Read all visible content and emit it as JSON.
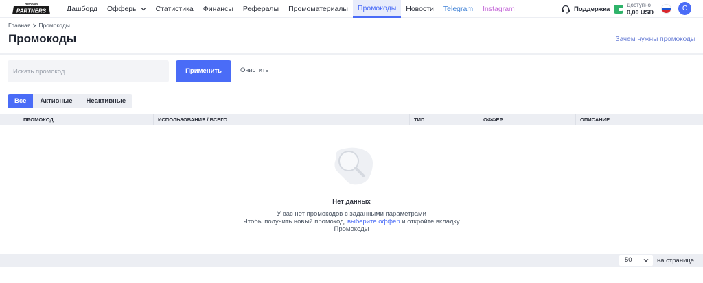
{
  "brand": {
    "logo_top": "BetBoom",
    "logo_main": "PARTNERS"
  },
  "nav": {
    "items": [
      {
        "label": "Дашборд"
      },
      {
        "label": "Офферы"
      },
      {
        "label": "Статистика"
      },
      {
        "label": "Финансы"
      },
      {
        "label": "Рефералы"
      },
      {
        "label": "Промоматериалы"
      },
      {
        "label": "Промокоды"
      },
      {
        "label": "Новости"
      },
      {
        "label": "Telegram"
      },
      {
        "label": "Instagram"
      }
    ],
    "active": "Промокоды"
  },
  "header": {
    "support": "Поддержка",
    "balance_label": "Доступно",
    "balance_value": "0,00 USD",
    "avatar_letter": "C"
  },
  "breadcrumb": {
    "home": "Главная",
    "current": "Промокоды"
  },
  "page": {
    "title": "Промокоды",
    "help_link": "Зачем нужны промокоды"
  },
  "search": {
    "placeholder": "Искать промокод",
    "value": "",
    "apply": "Применить",
    "clear": "Очистить"
  },
  "filters": [
    "Все",
    "Активные",
    "Неактивные"
  ],
  "table": {
    "columns": [
      "ПРОМОКОД",
      "ИСПОЛЬЗОВАНИЯ / ВСЕГО",
      "ТИП",
      "ОФФЕР",
      "ОПИСАНИЕ"
    ]
  },
  "empty": {
    "title": "Нет данных",
    "line1": "У вас нет промокодов с заданными параметрами",
    "line2_prefix": "Чтобы получить новый промокод, ",
    "line2_link": "выберите оффер",
    "line2_suffix": " и откройте вкладку",
    "line3": "Промокоды"
  },
  "pagination": {
    "per_page": "50",
    "label": "на странице"
  },
  "colors": {
    "accent": "#4a6cf7",
    "telegram": "#3d80d6",
    "instagram": "#c66bd9",
    "wallet": "#2fb36a"
  }
}
